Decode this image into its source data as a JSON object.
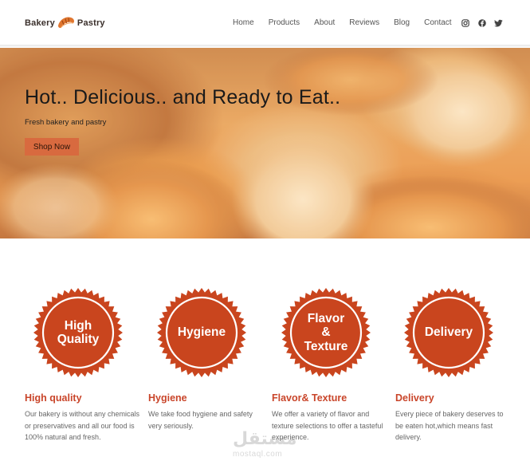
{
  "brand": {
    "name_left": "Bakery",
    "name_right": "Pastry",
    "icon": "croissant-icon"
  },
  "nav": {
    "items": [
      {
        "label": "Home"
      },
      {
        "label": "Products"
      },
      {
        "label": "About"
      },
      {
        "label": "Reviews"
      },
      {
        "label": "Blog"
      },
      {
        "label": "Contact"
      }
    ],
    "social": [
      "instagram-icon",
      "facebook-icon",
      "twitter-icon"
    ]
  },
  "hero": {
    "title": "Hot.. Delicious.. and Ready to Eat..",
    "subtitle": "Fresh bakery and pastry",
    "cta": "Shop Now"
  },
  "features": [
    {
      "badge": "High\nQuality",
      "title": "High quality",
      "desc": "Our bakery is without any chemicals or preservatives and all our food is 100% natural and fresh."
    },
    {
      "badge": "Hygiene",
      "title": "Hygiene",
      "desc": "We take food hygiene and safety very seriously."
    },
    {
      "badge": "Flavor\n&\nTexture",
      "title": "Flavor& Texture",
      "desc": "We offer a variety of flavor and texture selections to offer a tasteful experience."
    },
    {
      "badge": "Delivery",
      "title": "Delivery",
      "desc": "Every piece of bakery deserves to be eaten hot,which means fast delivery."
    }
  ],
  "watermark": {
    "arabic": "مستقل",
    "latin": "mostaql.com"
  },
  "colors": {
    "accent": "#c9452a",
    "button": "#d86a3f",
    "badge": "#c9451e"
  }
}
